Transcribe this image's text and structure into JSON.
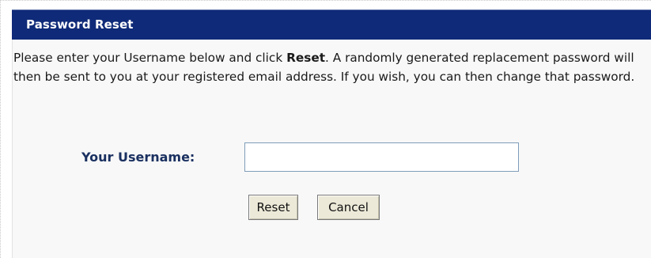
{
  "header": {
    "title": "Password Reset"
  },
  "intro": {
    "part1": "Please enter your Username below and click ",
    "bold": "Reset",
    "part2": ". A randomly generated replacement password will then be sent to you at your registered email address. If you wish, you can then change that password."
  },
  "form": {
    "username_label": "Your Username:",
    "username_value": "",
    "reset_label": "Reset",
    "cancel_label": "Cancel"
  },
  "colors": {
    "header_background": "#0f2a78",
    "label_text": "#1a3060"
  }
}
